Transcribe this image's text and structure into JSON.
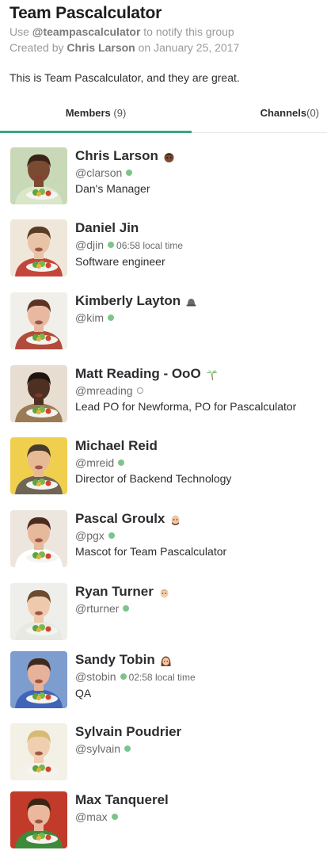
{
  "team": {
    "title": "Team Pascalculator",
    "use_prefix": "Use ",
    "handle": "@teampascalculator",
    "use_suffix": " to notify this group",
    "created_prefix": "Created by ",
    "creator": "Chris Larson",
    "created_suffix": " on January 25, 2017",
    "description": "This is Team Pascalculator, and they are great."
  },
  "tabs": {
    "members_label": "Members",
    "members_count": "(9)",
    "channels_label": "Channels",
    "channels_count": "(0)"
  },
  "colors": {
    "accent": "#3aa67f",
    "online": "#7cc589"
  },
  "members": [
    {
      "name": "Chris Larson",
      "handle": "@clarson",
      "presence": "online",
      "local_time": "",
      "role": "Dan's Manager",
      "status_emoji": "person-dark-icon",
      "bg": "#c9d9b8",
      "skin": "#7a4a32",
      "hair": "#3b2417",
      "shirt": "#d9e6c8"
    },
    {
      "name": "Daniel Jin",
      "handle": "@djin",
      "presence": "online",
      "local_time": "06:58 local time",
      "role": "Software engineer",
      "status_emoji": "",
      "bg": "#efe7da",
      "skin": "#e8c3a6",
      "hair": "#5a3b26",
      "shirt": "#c4463a"
    },
    {
      "name": "Kimberly Layton",
      "handle": "@kim",
      "presence": "online",
      "local_time": "",
      "role": "",
      "status_emoji": "hat-icon",
      "bg": "#f1efe9",
      "skin": "#e8b9a0",
      "hair": "#5a3523",
      "shirt": "#b24b3b"
    },
    {
      "name": "Matt Reading - OoO",
      "handle": "@mreading",
      "presence": "away",
      "local_time": "",
      "role": "Lead PO for Newforma, PO for Pascalculator",
      "status_emoji": "palm-tree-icon",
      "bg": "#e7ddd0",
      "skin": "#4e3022",
      "hair": "#1f140e",
      "shirt": "#9b7b55"
    },
    {
      "name": "Michael Reid",
      "handle": "@mreid",
      "presence": "online",
      "local_time": "",
      "role": "Director of Backend Technology",
      "status_emoji": "",
      "bg": "#f0cf4f",
      "skin": "#e6bb94",
      "hair": "#4a3a2c",
      "shirt": "#6e6554"
    },
    {
      "name": "Pascal Groulx",
      "handle": "@pgx",
      "presence": "online",
      "local_time": "",
      "role": "Mascot for Team Pascalculator",
      "status_emoji": "bald-man-icon",
      "bg": "#ece6df",
      "skin": "#e7b99b",
      "hair": "#4a2b1f",
      "shirt": "#ffffff"
    },
    {
      "name": "Ryan Turner",
      "handle": "@rturner",
      "presence": "online",
      "local_time": "",
      "role": "",
      "status_emoji": "man-icon",
      "bg": "#eeeeea",
      "skin": "#efc9ab",
      "hair": "#6b4a2f",
      "shirt": "#e9e9e4"
    },
    {
      "name": "Sandy Tobin",
      "handle": "@stobin",
      "presence": "online",
      "local_time": "02:58 local time",
      "role": "QA",
      "status_emoji": "woman-icon",
      "bg": "#7d9dcf",
      "skin": "#e7b29a",
      "hair": "#3f2a1e",
      "shirt": "#3f64b8"
    },
    {
      "name": "Sylvain Poudrier",
      "handle": "@sylvain",
      "presence": "online",
      "local_time": "",
      "role": "",
      "status_emoji": "",
      "bg": "#f3f0e6",
      "skin": "#efcfb0",
      "hair": "#d8bb72",
      "shirt": "#f4f1ea"
    },
    {
      "name": "Max Tanquerel",
      "handle": "@max",
      "presence": "online",
      "local_time": "",
      "role": "",
      "status_emoji": "",
      "bg": "#c23a2a",
      "skin": "#e9b89d",
      "hair": "#3a2416",
      "shirt": "#3f8a3a"
    }
  ]
}
